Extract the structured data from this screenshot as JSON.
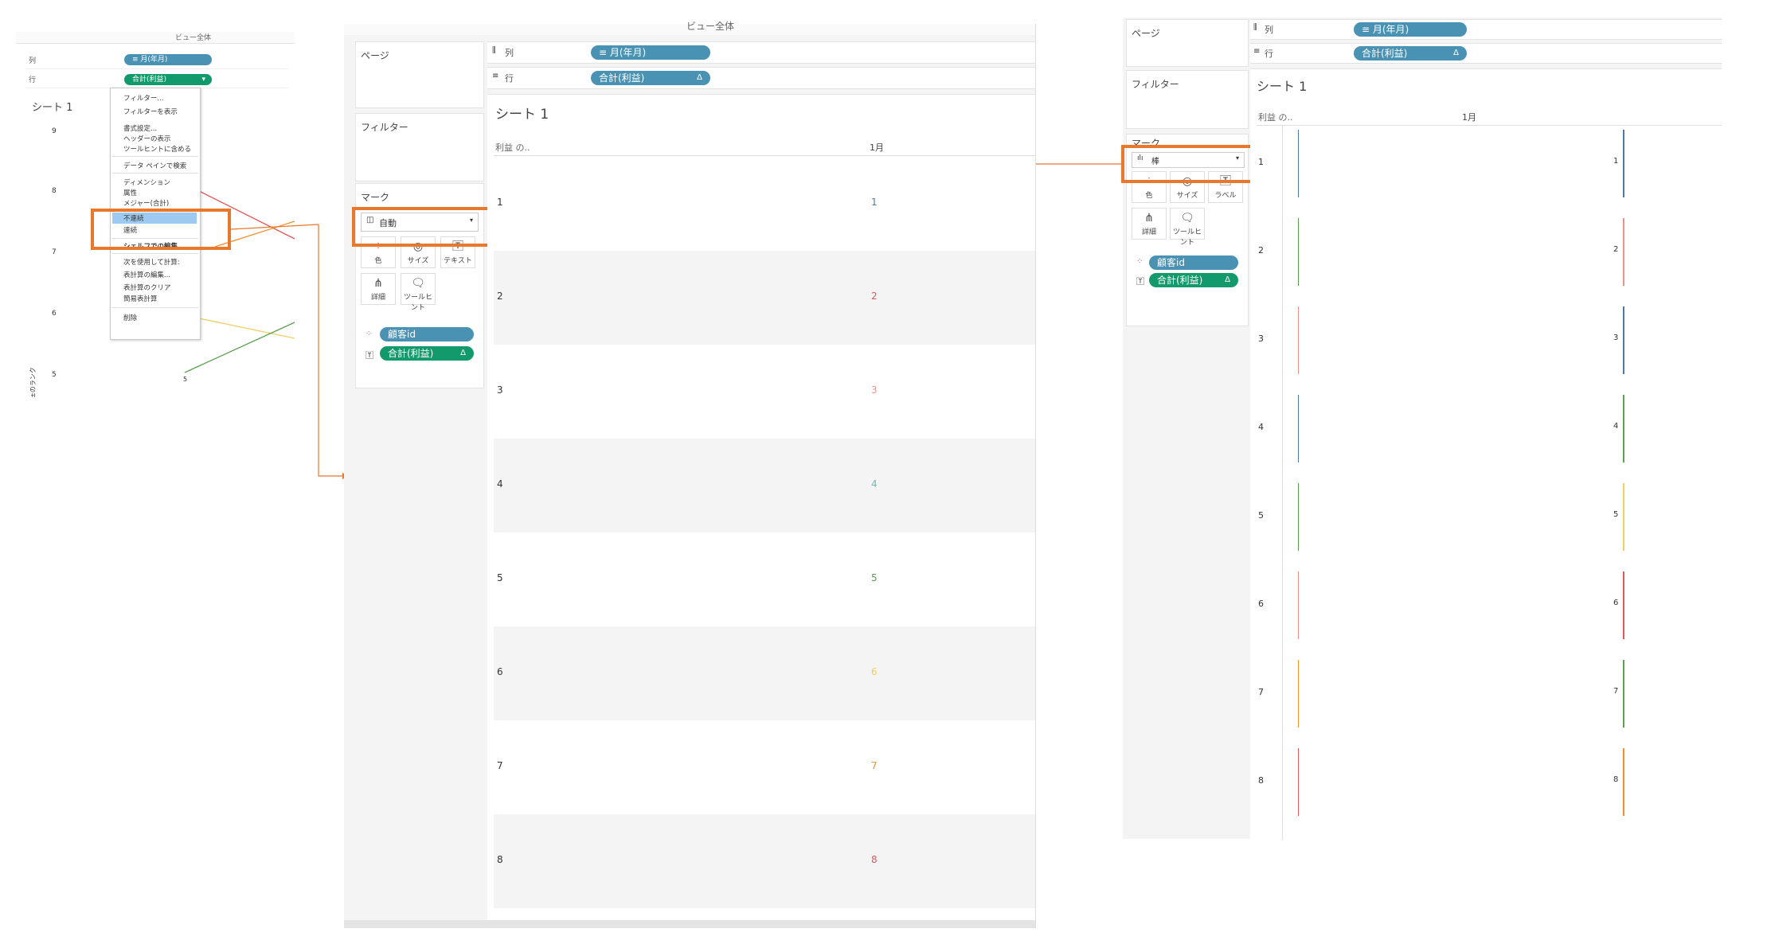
{
  "left": {
    "columns_label": "列",
    "rows_label": "行",
    "columns_pill": "≡ 月(年月)",
    "rows_pill": "合計(利益)",
    "view_dropdown": "ビュー全体",
    "sheet_title": "シート 1",
    "y_ticks": [
      "9",
      "8",
      "7",
      "6",
      "5"
    ],
    "y_axis_label": "±のランク",
    "point_label": "5",
    "menu": {
      "items": [
        "フィルター...",
        "フィルターを表示",
        "書式設定...",
        "ヘッダーの表示",
        "ツールヒントに含める",
        "データ ペインで検索",
        "ディメンション",
        "属性",
        "メジャー(合計)",
        "不連続",
        "連続",
        "シェルフでの編集",
        "次を使用して計算:",
        "表計算の編集...",
        "表計算のクリア",
        "簡易表計算",
        "削除"
      ]
    }
  },
  "middle": {
    "pages_label": "ページ",
    "filters_label": "フィルター",
    "marks_label": "マーク",
    "mark_type": "自動",
    "mark_buttons": [
      "色",
      "サイズ",
      "テキスト",
      "詳細",
      "ツールヒント"
    ],
    "columns_label": "列",
    "rows_label": "行",
    "columns_pill": "≡ 月(年月)",
    "rows_pill": "合計(利益)",
    "delta": "Δ",
    "view_dropdown": "ビュー全体",
    "sheet_title": "シート 1",
    "header_left": "利益 の..",
    "header_right": "1月",
    "mark_pills": [
      "顧客id",
      "合計(利益)"
    ],
    "rows": [
      "1",
      "2",
      "3",
      "4",
      "5",
      "6",
      "7",
      "8"
    ],
    "values": [
      "1",
      "2",
      "3",
      "4",
      "5",
      "6",
      "7",
      "8"
    ],
    "value_colors": [
      "#4e79a7",
      "#e15759",
      "#f28e8c",
      "#76b7b2",
      "#59a14f",
      "#f1ce63",
      "#f28e2b",
      "#e15759"
    ]
  },
  "right": {
    "pages_label": "ページ",
    "filters_label": "フィルター",
    "marks_label": "マーク",
    "mark_type": "棒",
    "mark_buttons": [
      "色",
      "サイズ",
      "ラベル",
      "詳細",
      "ツールヒント"
    ],
    "columns_label": "列",
    "rows_label": "行",
    "columns_pill": "≡ 月(年月)",
    "rows_pill": "合計(利益)",
    "delta": "Δ",
    "sheet_title": "シート 1",
    "header_left": "利益 の..",
    "header_right": "1月",
    "mark_pills": [
      "顧客id",
      "合計(利益)"
    ],
    "rows": [
      "1",
      "2",
      "3",
      "4",
      "5",
      "6",
      "7",
      "8"
    ],
    "values": [
      "1",
      "2",
      "3",
      "4",
      "5",
      "6",
      "7",
      "8"
    ],
    "bar_colors": [
      "#4e79a7",
      "#f28e8c",
      "#4e79a7",
      "#59a14f",
      "#f1ce63",
      "#e15759",
      "#59a14f",
      "#f28e2b"
    ],
    "left_bar_colors": [
      "#4e79a7",
      "#59a14f",
      "#f28e8c",
      "#4e79a7",
      "#59a14f",
      "#f28e8c",
      "#f28e2b",
      "#e15759"
    ]
  }
}
